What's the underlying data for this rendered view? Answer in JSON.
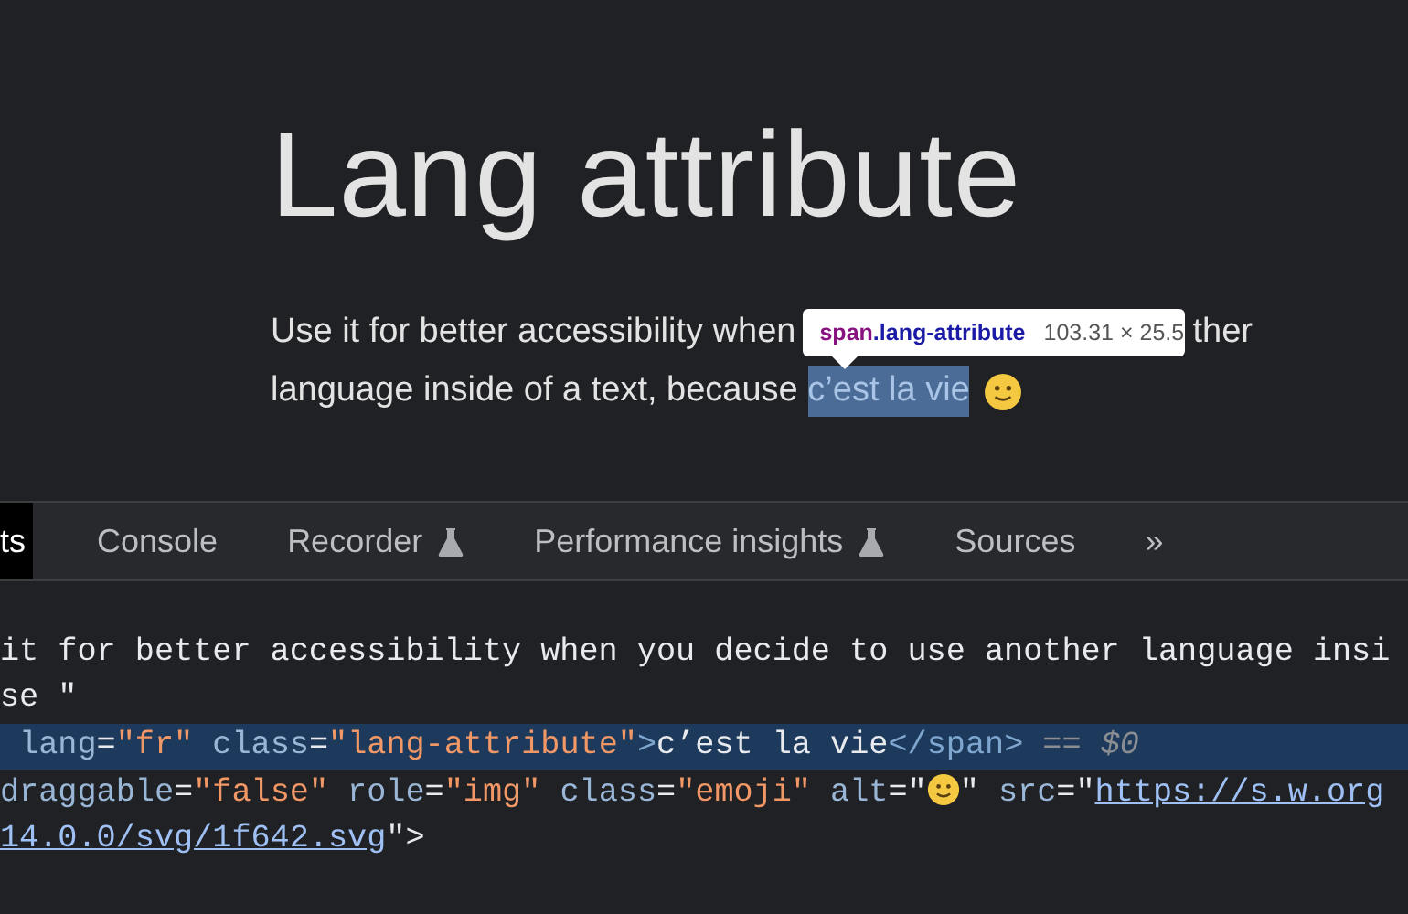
{
  "page": {
    "heading": "Lang attribute",
    "paragraph_line_1": {
      "before": "Use it for better accessibility when",
      "after": "ther"
    },
    "paragraph_line_2": {
      "text": "language inside of a text, because ",
      "highlighted": "c’est la vie"
    }
  },
  "tooltip": {
    "tag": "span",
    "class_name": ".lang-attribute",
    "size": "103.31 × 25.5"
  },
  "devtools": {
    "tabs": [
      {
        "label": "ts",
        "selected": true,
        "experimental": false
      },
      {
        "label": "Console",
        "selected": false,
        "experimental": false
      },
      {
        "label": "Recorder",
        "selected": false,
        "experimental": true
      },
      {
        "label": "Performance insights",
        "selected": false,
        "experimental": true
      },
      {
        "label": "Sources",
        "selected": false,
        "experimental": false
      }
    ],
    "more_tabs": "»",
    "code_lines": [
      {
        "selected": false,
        "segments": [
          {
            "kind": "text",
            "text": "it for better accessibility when you decide to use another language insi"
          }
        ]
      },
      {
        "selected": false,
        "segments": [
          {
            "kind": "text",
            "text": "se \""
          }
        ]
      },
      {
        "selected": true,
        "segments": [
          {
            "kind": "attr",
            "text": " lang"
          },
          {
            "kind": "text",
            "text": "="
          },
          {
            "kind": "value",
            "text": "\"fr\""
          },
          {
            "kind": "attr",
            "text": " class"
          },
          {
            "kind": "text",
            "text": "="
          },
          {
            "kind": "value",
            "text": "\"lang-attribute\""
          },
          {
            "kind": "tag",
            "text": ">"
          },
          {
            "kind": "text",
            "text": "c’est la vie"
          },
          {
            "kind": "tag",
            "text": "</span>"
          },
          {
            "kind": "muted",
            "text": " == "
          },
          {
            "kind": "var",
            "text": "$0"
          }
        ]
      },
      {
        "selected": false,
        "segments": [
          {
            "kind": "attr",
            "text": "draggable"
          },
          {
            "kind": "text",
            "text": "="
          },
          {
            "kind": "value",
            "text": "\"false\""
          },
          {
            "kind": "attr",
            "text": " role"
          },
          {
            "kind": "text",
            "text": "="
          },
          {
            "kind": "value",
            "text": "\"img\""
          },
          {
            "kind": "attr",
            "text": " class"
          },
          {
            "kind": "text",
            "text": "="
          },
          {
            "kind": "value",
            "text": "\"emoji\""
          },
          {
            "kind": "attr",
            "text": " alt"
          },
          {
            "kind": "text",
            "text": "=\""
          },
          {
            "kind": "emoji"
          },
          {
            "kind": "text",
            "text": "\""
          },
          {
            "kind": "attr",
            "text": " src"
          },
          {
            "kind": "text",
            "text": "=\""
          },
          {
            "kind": "link",
            "text": "https://s.w.org"
          }
        ]
      },
      {
        "selected": false,
        "segments": [
          {
            "kind": "link",
            "text": "14.0.0/svg/1f642.svg"
          },
          {
            "kind": "text",
            "text": "\">"
          }
        ]
      }
    ]
  }
}
